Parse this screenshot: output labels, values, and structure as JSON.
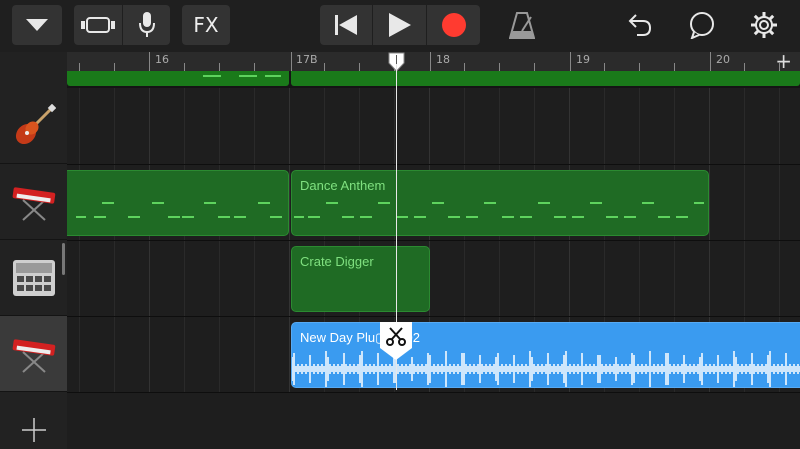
{
  "toolbar": {
    "fx_label": "FX",
    "icons": [
      "chevron-down-icon",
      "browser-view-icon",
      "microphone-icon",
      "rewind-icon",
      "play-icon",
      "record-icon",
      "metronome-icon",
      "undo-icon",
      "loop-icon",
      "settings-icon"
    ],
    "record_color": "#ff3b30"
  },
  "ruler": {
    "bars": [
      {
        "label": "16"
      },
      {
        "label": "17B"
      },
      {
        "label": "18"
      },
      {
        "label": "19"
      },
      {
        "label": "20"
      }
    ],
    "add_section_label": "+"
  },
  "tracks": [
    {
      "instrument": "guitar-icon",
      "selected": false
    },
    {
      "instrument": "keyboard-icon",
      "selected": false
    },
    {
      "instrument": "drum-machine-icon",
      "selected": false
    },
    {
      "instrument": "keyboard-icon",
      "selected": true
    }
  ],
  "regions": {
    "keyboard_left": {
      "label": "",
      "color": "#1f6b24"
    },
    "dance_anthem": {
      "label": "Dance Anthem",
      "color": "#1f6b24"
    },
    "crate_digger": {
      "label": "Crate Digger",
      "color": "#1f6b24"
    },
    "new_day": {
      "label": "New Day Plu▢ad 02",
      "color": "#3a9bf0"
    }
  },
  "add_track_label": "+"
}
